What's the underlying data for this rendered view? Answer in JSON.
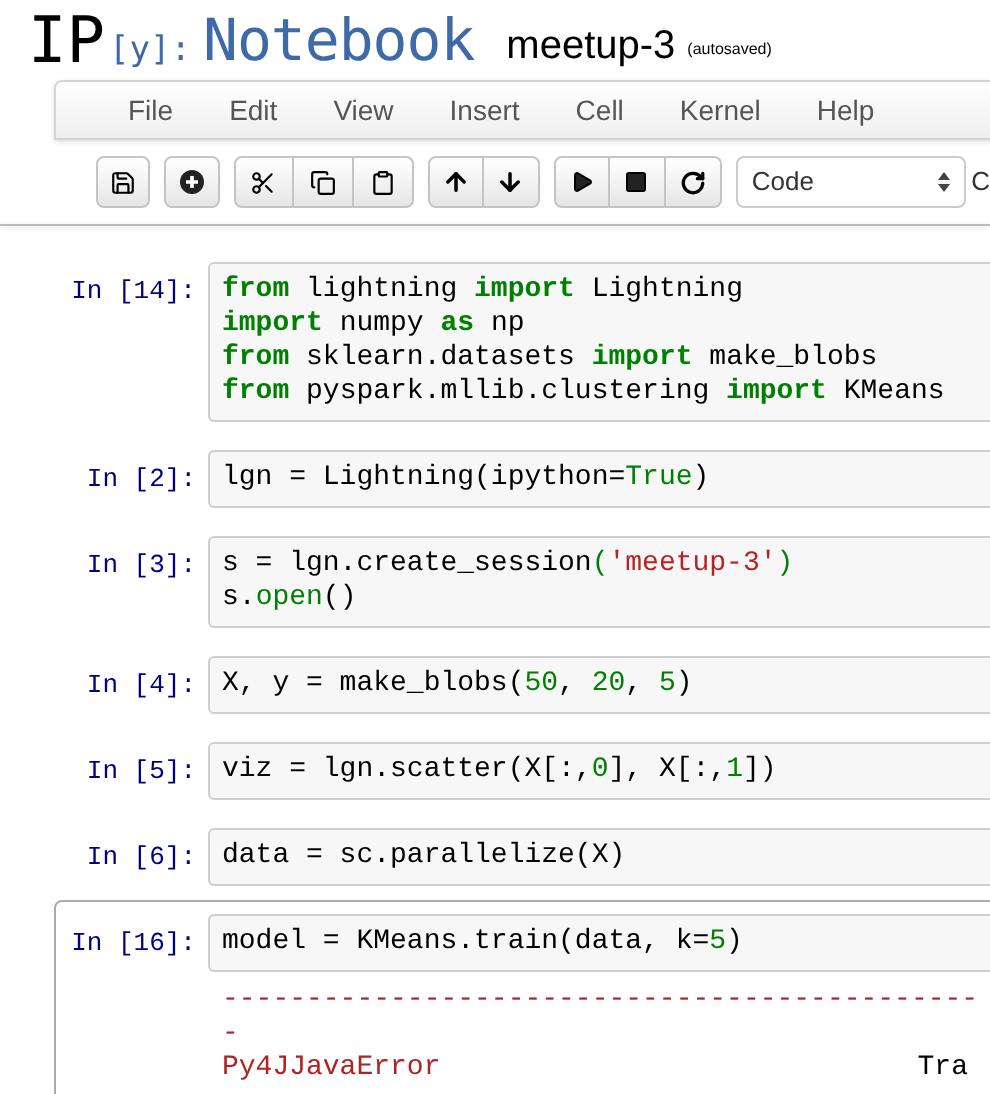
{
  "header": {
    "logo_ip": "IP",
    "logo_y": "[y]:",
    "logo_notebook": "Notebook",
    "notebook_name": "meetup-3",
    "save_status": "(autosaved)"
  },
  "menu": [
    "File",
    "Edit",
    "View",
    "Insert",
    "Cell",
    "Kernel",
    "Help"
  ],
  "toolbar": {
    "cell_type": "Code",
    "cut_label": "C"
  },
  "cells": [
    {
      "prompt": "In [14]:",
      "selected": false,
      "lines": [
        [
          {
            "kind": "keyword",
            "text": "from"
          },
          {
            "kind": "text",
            "text": " lightning "
          },
          {
            "kind": "keyword",
            "text": "import"
          },
          {
            "kind": "text",
            "text": " Lightning"
          }
        ],
        [
          {
            "kind": "keyword",
            "text": "import"
          },
          {
            "kind": "text",
            "text": " numpy "
          },
          {
            "kind": "keyword",
            "text": "as"
          },
          {
            "kind": "text",
            "text": " np"
          }
        ],
        [
          {
            "kind": "keyword",
            "text": "from"
          },
          {
            "kind": "text",
            "text": " sklearn.datasets "
          },
          {
            "kind": "keyword",
            "text": "import"
          },
          {
            "kind": "text",
            "text": " make_blobs"
          }
        ],
        [
          {
            "kind": "keyword",
            "text": "from"
          },
          {
            "kind": "text",
            "text": " pyspark.mllib.clustering "
          },
          {
            "kind": "keyword",
            "text": "import"
          },
          {
            "kind": "text",
            "text": " KMeans"
          }
        ]
      ]
    },
    {
      "prompt": "In [2]:",
      "selected": false,
      "lines": [
        [
          {
            "kind": "text",
            "text": "lgn = Lightning(ipython="
          },
          {
            "kind": "literal",
            "text": "True"
          },
          {
            "kind": "text",
            "text": ")"
          }
        ]
      ]
    },
    {
      "prompt": "In [3]:",
      "selected": false,
      "lines": [
        [
          {
            "kind": "text",
            "text": "s = lgn.create_session"
          },
          {
            "kind": "literal",
            "text": "("
          },
          {
            "kind": "string",
            "text": "'meetup-3'"
          },
          {
            "kind": "literal",
            "text": ")"
          }
        ],
        [
          {
            "kind": "text",
            "text": "s."
          },
          {
            "kind": "literal",
            "text": "open"
          },
          {
            "kind": "text",
            "text": "()"
          }
        ]
      ]
    },
    {
      "prompt": "In [4]:",
      "selected": false,
      "lines": [
        [
          {
            "kind": "text",
            "text": "X, y = make_blobs("
          },
          {
            "kind": "literal",
            "text": "50"
          },
          {
            "kind": "text",
            "text": ", "
          },
          {
            "kind": "literal",
            "text": "20"
          },
          {
            "kind": "text",
            "text": ", "
          },
          {
            "kind": "literal",
            "text": "5"
          },
          {
            "kind": "text",
            "text": ")"
          }
        ]
      ]
    },
    {
      "prompt": "In [5]:",
      "selected": false,
      "lines": [
        [
          {
            "kind": "text",
            "text": "viz = lgn.scatter(X[:,"
          },
          {
            "kind": "literal",
            "text": "0"
          },
          {
            "kind": "text",
            "text": "], X[:,"
          },
          {
            "kind": "literal",
            "text": "1"
          },
          {
            "kind": "text",
            "text": "])"
          }
        ]
      ]
    },
    {
      "prompt": "In [6]:",
      "selected": false,
      "lines": [
        [
          {
            "kind": "text",
            "text": "data = sc.parallelize(X)"
          }
        ]
      ]
    },
    {
      "prompt": "In [16]:",
      "selected": true,
      "lines": [
        [
          {
            "kind": "text",
            "text": "model = KMeans.train(data, k="
          },
          {
            "kind": "literal",
            "text": "5"
          },
          {
            "kind": "text",
            "text": ")"
          }
        ]
      ],
      "output": {
        "rule": "---------------------------------------------",
        "rule_end": "-",
        "error_name": "Py4JJavaError",
        "column_2": "Tra"
      }
    }
  ]
}
